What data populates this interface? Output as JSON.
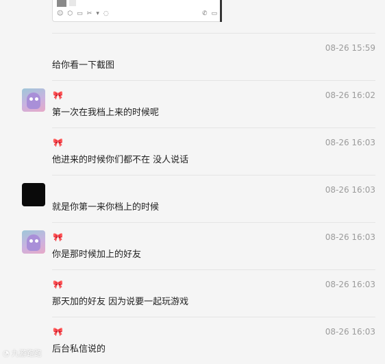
{
  "screenshot_preview": {
    "toolbar_icons": [
      "emoji-icon",
      "cube-icon",
      "folder-icon",
      "scissors-icon",
      "dropdown-icon",
      "chat-history-icon",
      "phone-icon",
      "video-icon"
    ]
  },
  "messages": [
    {
      "time": "08-26 15:59",
      "text": "给你看一下截图",
      "avatar": null,
      "badge": null
    },
    {
      "time": "08-26 16:02",
      "text": "第一次在我档上来的时候呢",
      "avatar": "character",
      "badge": "🎀"
    },
    {
      "time": "08-26 16:03",
      "text": "他进来的时候你们都不在 没人说话",
      "avatar": null,
      "badge": "🎀"
    },
    {
      "time": "08-26 16:03",
      "text": "就是你第一来你档上的时候",
      "avatar": "dark",
      "badge": null
    },
    {
      "time": "08-26 16:03",
      "text": "你是那时候加上的好友",
      "avatar": "character",
      "badge": "🎀"
    },
    {
      "time": "08-26 16:03",
      "text": "那天加的好友 因为说要一起玩游戏",
      "avatar": null,
      "badge": "🎀"
    },
    {
      "time": "08-26 16:03",
      "text": "后台私信说的",
      "avatar": null,
      "badge": "🎀"
    }
  ],
  "watermark": {
    "text": "九游跑跑",
    "icon": "watermark-logo-icon"
  },
  "colors": {
    "background": "#f5f5f5",
    "divider": "#e4e4e4",
    "time": "#9b9b9b",
    "text": "#222222",
    "badge": "#e83b8a"
  }
}
